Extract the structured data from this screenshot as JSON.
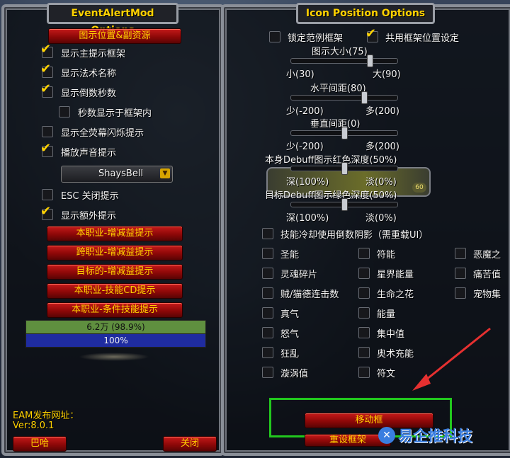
{
  "left": {
    "title": "EventAlertMod Options",
    "top_button": "图示位置&副资源",
    "checkboxes": [
      {
        "label": "显示主提示框架",
        "checked": true
      },
      {
        "label": "显示法术名称",
        "checked": true
      },
      {
        "label": "显示倒数秒数",
        "checked": true
      },
      {
        "label": "秒数显示于框架内",
        "checked": false
      },
      {
        "label": "显示全荧幕闪烁提示",
        "checked": false
      },
      {
        "label": "播放声音提示",
        "checked": true
      }
    ],
    "sound_dropdown": "ShaysBell",
    "esc_label": "ESC 关闭提示",
    "extra_label": "显示额外提示",
    "buttons": [
      "本职业-增减益提示",
      "跨职业-增减益提示",
      "目标的-增减益提示",
      "本职业-技能CD提示",
      "本职业-条件技能提示"
    ],
    "health_text": "6.2万 (98.9%)",
    "power_text": "100%",
    "url_label": "EAM发布网址：",
    "version": "Ver:8.0.1",
    "bottom_left_button": "巴哈",
    "close_button": "关闭"
  },
  "right": {
    "title": "Icon Position Options",
    "lock_label": "锁定范例框架",
    "shared_label": "共用框架位置设定",
    "sliders": [
      {
        "title": "图示大小(75)",
        "min": "小(30)",
        "max": "大(90)",
        "level": 0.75
      },
      {
        "title": "水平间距(80)",
        "min": "少(-200)",
        "max": "多(200)",
        "level": 0.7
      },
      {
        "title": "垂直间距(0)",
        "min": "少(-200)",
        "max": "多(200)",
        "level": 0.5
      },
      {
        "title": "本身Debuff图示红色深度(50%)",
        "min": "深(100%)",
        "max": "淡(0%)",
        "level": 0.5
      },
      {
        "title": "目标Debuff图示绿色深度(50%)",
        "min": "深(100%)",
        "max": "淡(0%)",
        "level": 0.5
      }
    ],
    "cooldown_label": "技能冷却使用倒数阴影（需重载UI）",
    "resources": [
      [
        "圣能",
        "符能",
        "恶魔之"
      ],
      [
        "灵魂碎片",
        "星界能量",
        "痛苦值"
      ],
      [
        "贼/猫德连击数",
        "生命之花",
        "宠物集"
      ],
      [
        "真气",
        "能量",
        ""
      ],
      [
        "怒气",
        "集中值",
        ""
      ],
      [
        "狂乱",
        "奥术充能",
        ""
      ],
      [
        "漩涡值",
        "符文",
        ""
      ]
    ],
    "move_button": "移动框",
    "reset_button": "重设框架",
    "watermark": "易企推科技",
    "icon_level": "60"
  },
  "colors": {
    "health": "#5f8f3f",
    "power": "#1f2ca0",
    "highlight": "#22c81e",
    "arrow": "#e53030",
    "watermark": "#3a7ee0"
  }
}
